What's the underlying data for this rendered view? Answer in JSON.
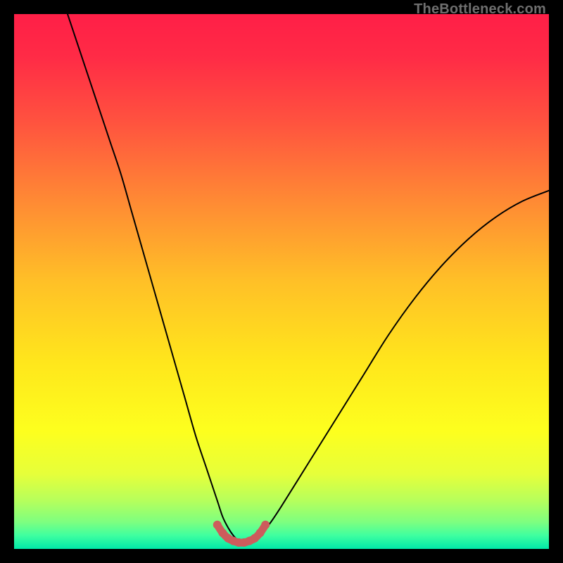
{
  "watermark": "TheBottleneck.com",
  "colors": {
    "frame": "#000000",
    "gradient_stops": [
      {
        "offset": 0.0,
        "color": "#ff1f47"
      },
      {
        "offset": 0.08,
        "color": "#ff2b46"
      },
      {
        "offset": 0.2,
        "color": "#ff523f"
      },
      {
        "offset": 0.35,
        "color": "#ff8a34"
      },
      {
        "offset": 0.5,
        "color": "#ffc027"
      },
      {
        "offset": 0.65,
        "color": "#ffe61c"
      },
      {
        "offset": 0.78,
        "color": "#fdff1e"
      },
      {
        "offset": 0.86,
        "color": "#e6ff3a"
      },
      {
        "offset": 0.91,
        "color": "#b6ff5c"
      },
      {
        "offset": 0.95,
        "color": "#7dff80"
      },
      {
        "offset": 0.975,
        "color": "#3effa0"
      },
      {
        "offset": 1.0,
        "color": "#00e8a8"
      }
    ],
    "curve_stroke": "#000000",
    "marker_stroke": "#cd5c5c",
    "marker_fill": "#cd5c5c"
  },
  "chart_data": {
    "type": "line",
    "title": "",
    "xlabel": "",
    "ylabel": "",
    "xlim": [
      0,
      100
    ],
    "ylim": [
      0,
      100
    ],
    "grid": false,
    "legend": false,
    "series": [
      {
        "name": "bottleneck-curve",
        "x": [
          10,
          12,
          14,
          16,
          18,
          20,
          22,
          24,
          26,
          28,
          30,
          32,
          34,
          36,
          38,
          39,
          40,
          41,
          42,
          43,
          44,
          45,
          46,
          48,
          50,
          55,
          60,
          65,
          70,
          75,
          80,
          85,
          90,
          95,
          100
        ],
        "y": [
          100,
          94,
          88,
          82,
          76,
          70,
          63,
          56,
          49,
          42,
          35,
          28,
          21,
          15,
          9,
          6,
          4,
          2.5,
          1.5,
          1,
          1,
          1.5,
          2.5,
          5,
          8,
          16,
          24,
          32,
          40,
          47,
          53,
          58,
          62,
          65,
          67
        ]
      },
      {
        "name": "optimal-flat-region",
        "x": [
          38,
          39,
          40,
          41,
          42,
          43,
          44,
          45,
          46,
          47
        ],
        "y": [
          4.5,
          3.0,
          2.0,
          1.5,
          1.2,
          1.2,
          1.5,
          2.0,
          3.0,
          4.5
        ]
      }
    ],
    "annotations": []
  }
}
